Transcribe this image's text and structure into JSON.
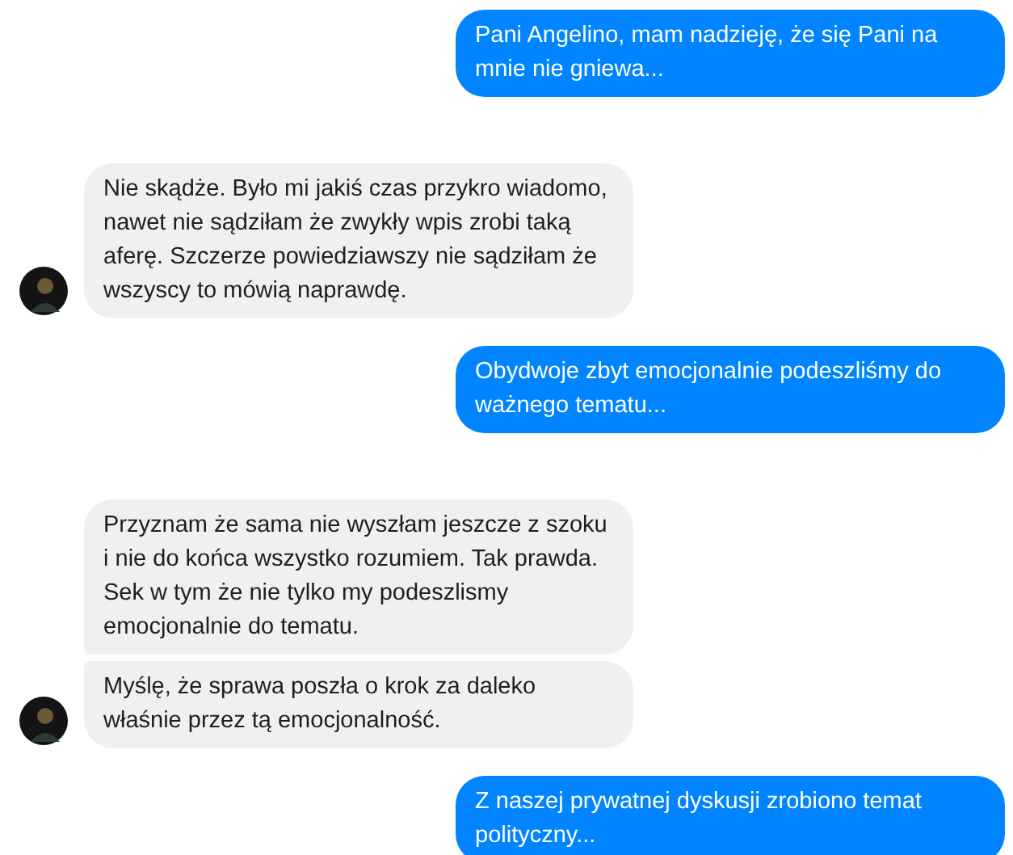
{
  "groups": [
    {
      "kind": "outgoing",
      "messages": [
        "Pani Angelino, mam nadzieję, że się Pani na mnie nie gniewa..."
      ]
    },
    {
      "kind": "incoming",
      "messages": [
        "Nie skądże. Było mi jakiś czas przykro wiadomo, nawet nie sądziłam że zwykły wpis zrobi taką aferę. Szczerze powiedziawszy nie sądziłam że wszyscy to mówią naprawdę."
      ]
    },
    {
      "kind": "outgoing",
      "messages": [
        "Obydwoje zbyt emocjonalnie podeszliśmy do ważnego tematu..."
      ]
    },
    {
      "kind": "incoming",
      "messages": [
        "Przyznam że sama nie wyszłam jeszcze z szoku i nie do końca wszystko rozumiem. Tak prawda. Sek w tym że nie tylko my podeszlismy emocjonalnie do tematu.",
        "Myślę, że sprawa poszła o krok za daleko właśnie przez tą emocjonalność."
      ]
    },
    {
      "kind": "outgoing",
      "messages": [
        "Z naszej prywatnej dyskusji zrobiono temat polityczny..."
      ]
    }
  ]
}
